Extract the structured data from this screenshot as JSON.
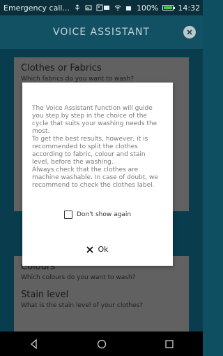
{
  "status_bar": {
    "notification": "Emergency call...",
    "battery": "100%",
    "time": "14:32"
  },
  "app_bar": {
    "title": "VOICE ASSISTANT",
    "close_icon": "close-circle-icon"
  },
  "background": {
    "top_card": {
      "title": "Clothes or Fabrics",
      "question": "Which fabrics do you want to wash?"
    },
    "bottom_card": {
      "sections": [
        {
          "title": "Colours",
          "question": "Which colours do you want to wash?"
        },
        {
          "title": "Stain level",
          "question": "What is the stain level of your clothes?"
        }
      ]
    }
  },
  "dialog": {
    "message": "The Voice Assistant function will guide you step by step in the choice of the cycle that suits your washing needs the most.\nTo get the best results, however, it is recommended to split the clothes according to fabric, colour and stain level, before the washing.\nAlways check that the clothes are machine washable. In case of doubt, we recommend to check the clothes label.",
    "checkbox_label": "Don't show again",
    "checkbox_checked": false,
    "ok_label": "Ok"
  },
  "nav_bar": {
    "icons": [
      "back-icon",
      "home-icon",
      "recents-icon"
    ]
  },
  "colors": {
    "app_bar": "#155c71",
    "status_bar": "#0a2f3a",
    "dialog_bg": "#ffffff"
  }
}
